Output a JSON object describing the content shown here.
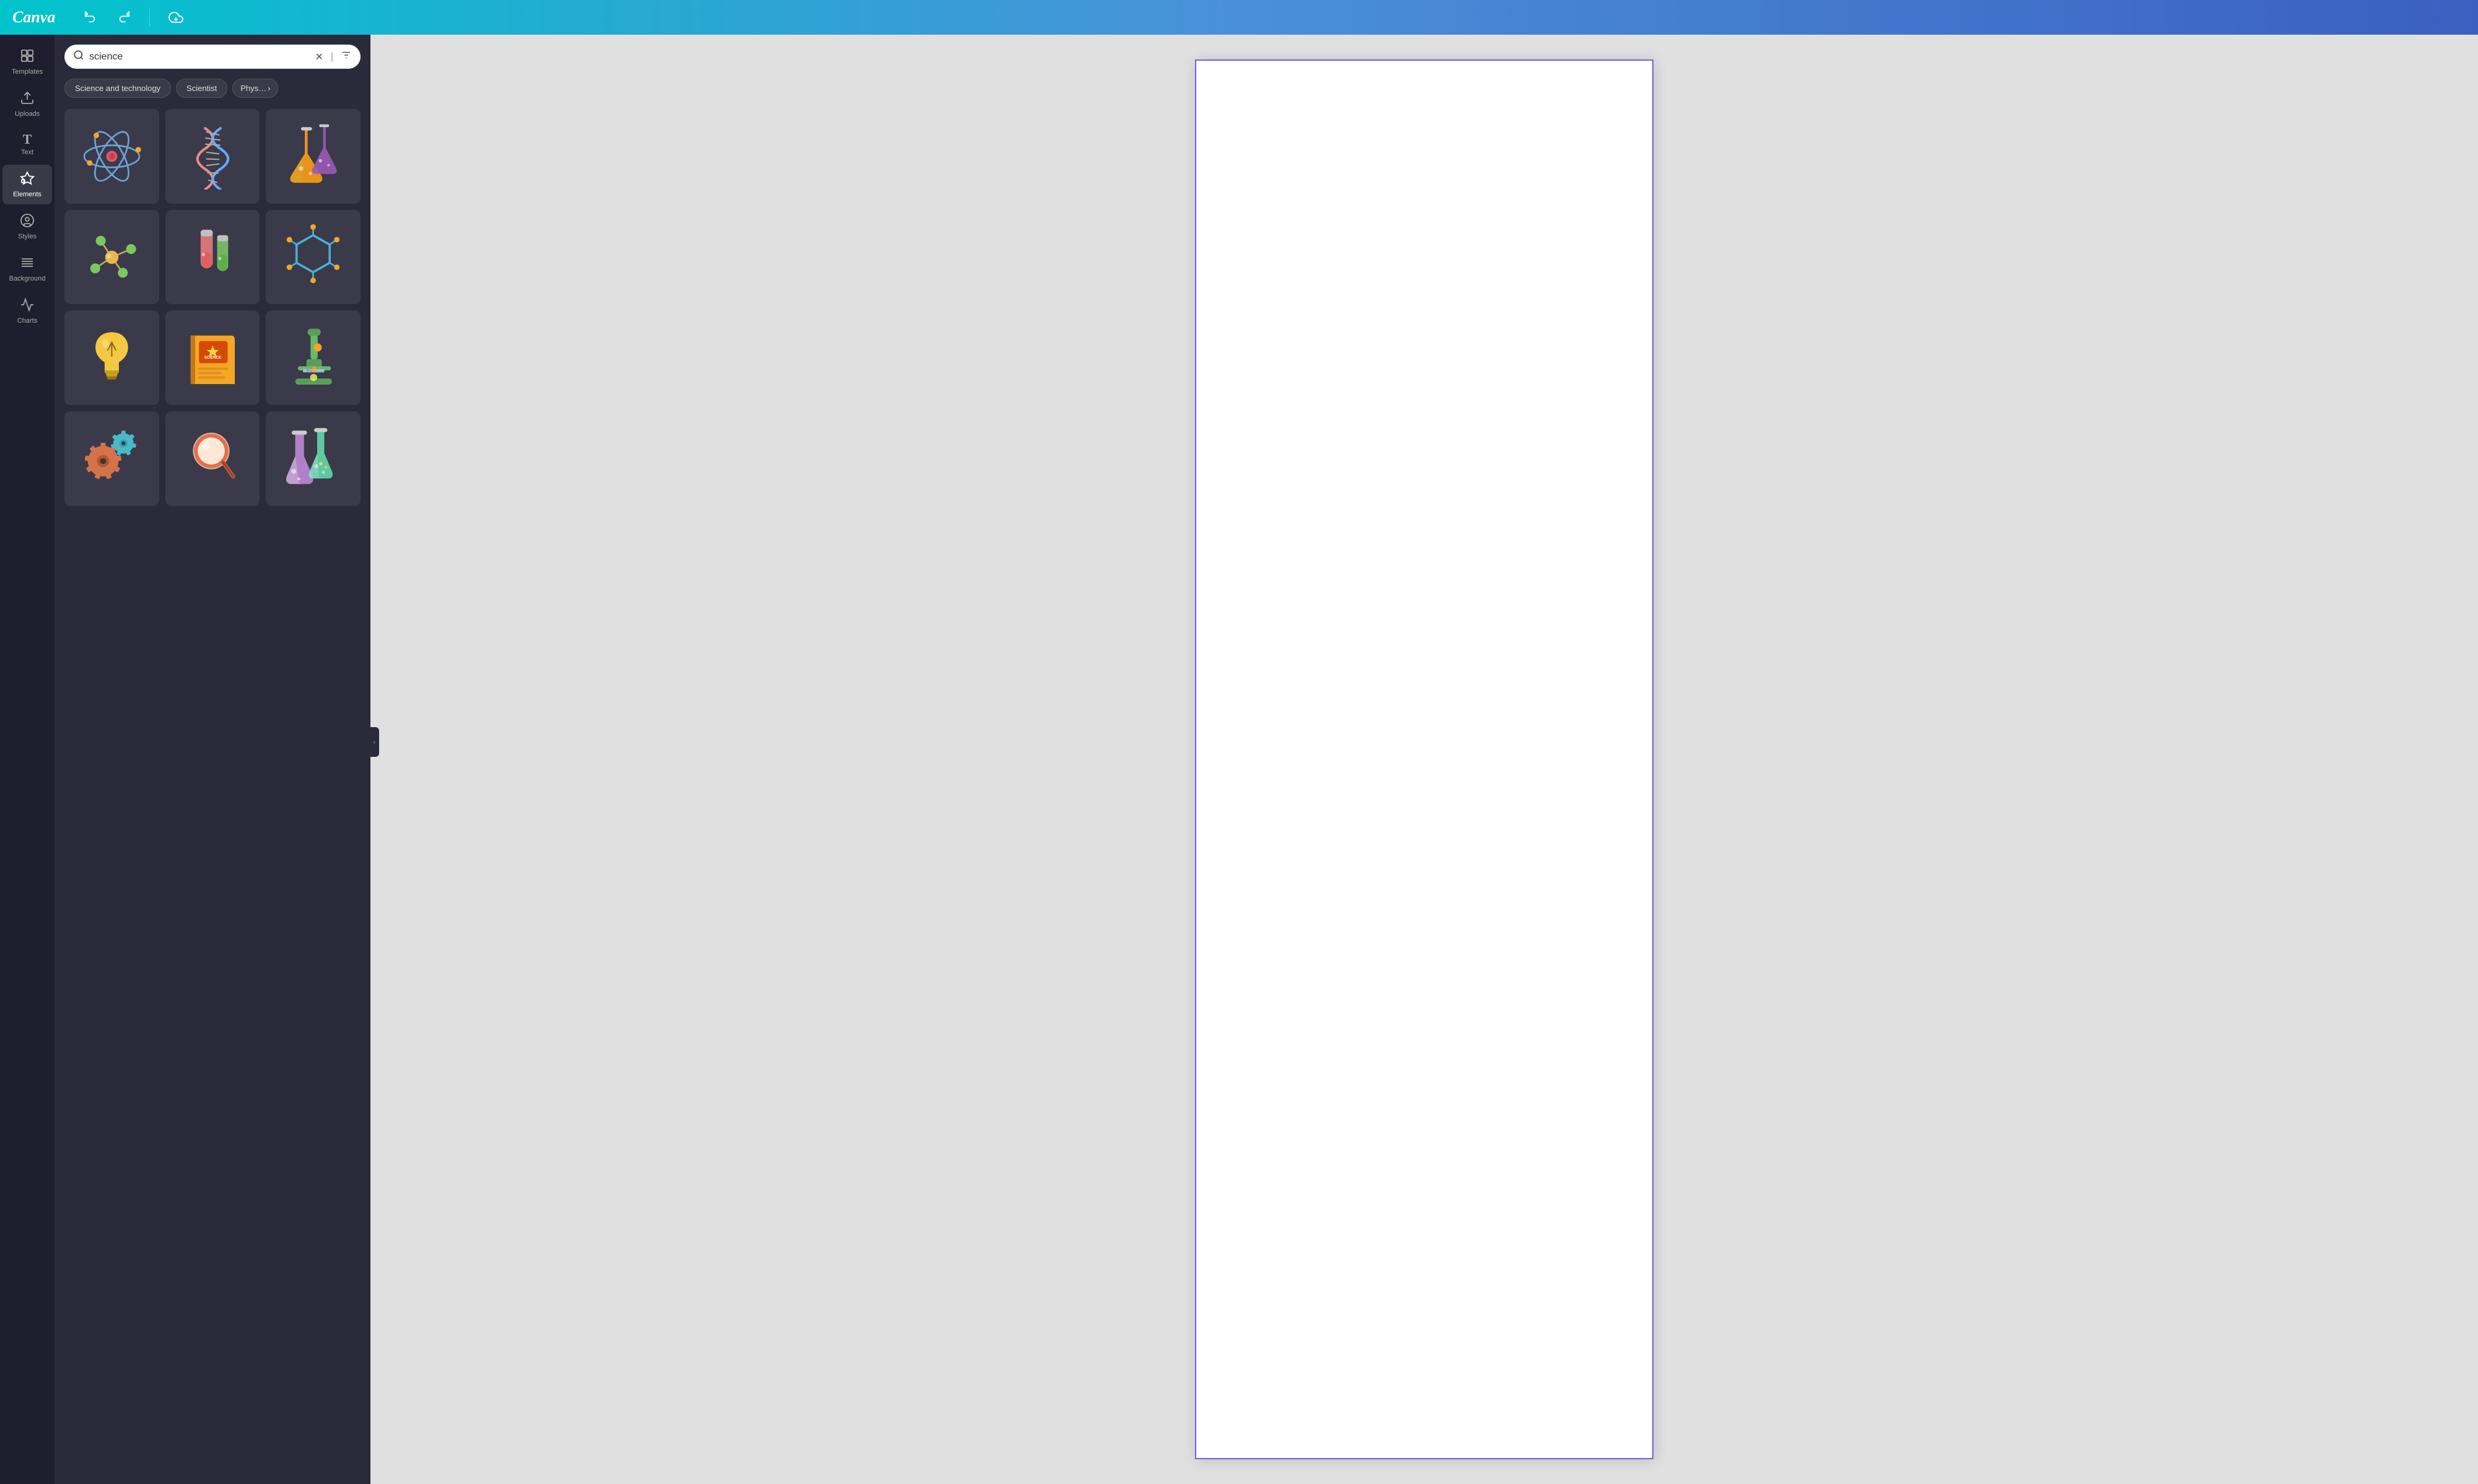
{
  "topbar": {
    "logo": "Canva",
    "undo_label": "↩",
    "redo_label": "↪",
    "cloud_label": "☁"
  },
  "sidebar": {
    "items": [
      {
        "id": "templates",
        "icon": "⊞",
        "label": "Templates"
      },
      {
        "id": "uploads",
        "icon": "⬆",
        "label": "Uploads"
      },
      {
        "id": "text",
        "icon": "T",
        "label": "Text"
      },
      {
        "id": "elements",
        "icon": "◇",
        "label": "Elements",
        "active": true
      },
      {
        "id": "styles",
        "icon": "☺",
        "label": "Styles"
      },
      {
        "id": "background",
        "icon": "≡",
        "label": "Background"
      },
      {
        "id": "charts",
        "icon": "📈",
        "label": "Charts"
      }
    ]
  },
  "panel": {
    "search": {
      "value": "science",
      "placeholder": "Search"
    },
    "chips": [
      {
        "label": "Science and technology"
      },
      {
        "label": "Scientist"
      },
      {
        "label": "Phys…"
      }
    ],
    "grid_items": [
      {
        "id": "atom",
        "desc": "atom icon"
      },
      {
        "id": "dna",
        "desc": "DNA helix icon"
      },
      {
        "id": "flasks",
        "desc": "science flasks icon"
      },
      {
        "id": "molecule",
        "desc": "molecule icon"
      },
      {
        "id": "test-tubes",
        "desc": "test tubes icon"
      },
      {
        "id": "hexagon",
        "desc": "hexagon molecule icon"
      },
      {
        "id": "lightbulb",
        "desc": "lightbulb icon"
      },
      {
        "id": "book",
        "desc": "science book icon"
      },
      {
        "id": "microscope",
        "desc": "microscope icon"
      },
      {
        "id": "gears",
        "desc": "gears icon"
      },
      {
        "id": "magnifier",
        "desc": "magnifying glass icon"
      },
      {
        "id": "beakers",
        "desc": "beakers icon"
      }
    ]
  },
  "canvas": {
    "doc_label": "document canvas"
  },
  "colors": {
    "accent_purple": "#7c5cde",
    "sidebar_bg": "#1e1e2e",
    "panel_bg": "#2a2a3a",
    "topbar_start": "#00c4cc",
    "topbar_end": "#3b5fc0"
  }
}
